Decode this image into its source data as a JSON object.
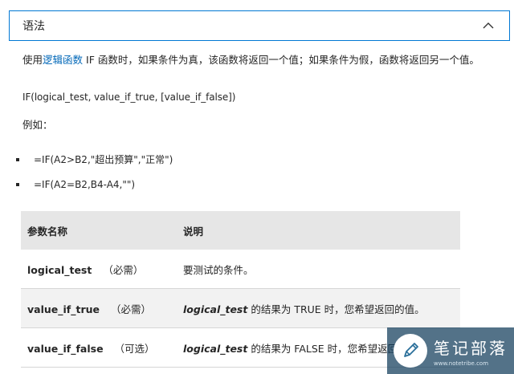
{
  "accordion": {
    "title": "语法",
    "expanded": true,
    "border_color": "#0078d4"
  },
  "intro": {
    "before_link": "使用",
    "link_text": "逻辑函数",
    "after_link": " IF 函数时，如果条件为真，该函数将返回一个值；如果条件为假，函数将返回另一个值。"
  },
  "syntax": "IF(logical_test, value_if_true, [value_if_false])",
  "example_label": "例如：",
  "examples": [
    "=IF(A2>B2,\"超出预算\",\"正常\")",
    "=IF(A2=B2,B4-A4,\"\")"
  ],
  "table": {
    "headers": {
      "name": "参数名称",
      "description": "说明"
    },
    "rows": [
      {
        "name": "logical_test",
        "note": "（必需）",
        "desc_emph": "",
        "desc": "要测试的条件。"
      },
      {
        "name": "value_if_true",
        "note": "（必需）",
        "desc_emph": "logical_test",
        "desc": " 的结果为 TRUE 时，您希望返回的值。"
      },
      {
        "name": "value_if_false",
        "note": "（可选）",
        "desc_emph": "logical_test",
        "desc": " 的结果为 FALSE 时，您希望返回的值。"
      }
    ]
  },
  "watermark": {
    "name": "笔记部落",
    "url": "www.notetribe.com",
    "icon": "pencil-icon"
  },
  "colors": {
    "link": "#0067b8",
    "header_bg": "#e6e6e6",
    "text": "#262626"
  }
}
